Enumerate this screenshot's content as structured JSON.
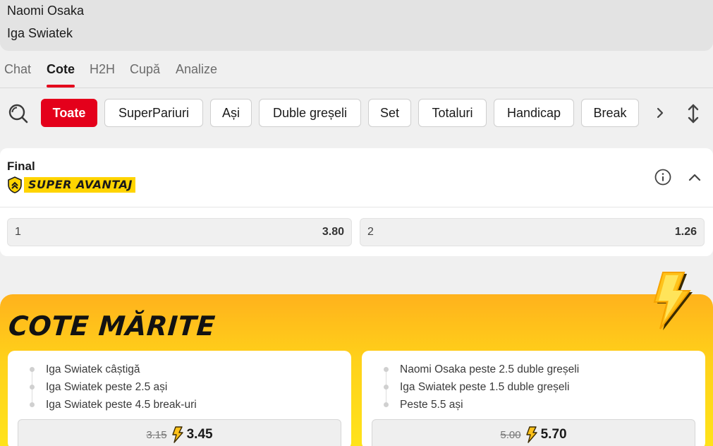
{
  "match": {
    "player1": "Naomi Osaka",
    "player2": "Iga Swiatek"
  },
  "tabs": [
    "Chat",
    "Cote",
    "H2H",
    "Cupă",
    "Analize"
  ],
  "active_tab": "Cote",
  "filters": [
    "Toate",
    "SuperPariuri",
    "Ași",
    "Duble greșeli",
    "Set",
    "Totaluri",
    "Handicap",
    "Break"
  ],
  "active_filter": "Toate",
  "market": {
    "title": "Final",
    "badge": "SUPER AVANTAJ",
    "outcomes": [
      {
        "label": "1",
        "odd": "3.80"
      },
      {
        "label": "2",
        "odd": "1.26"
      }
    ]
  },
  "boosted": {
    "title": "COTE MĂRITE",
    "cards": [
      {
        "selections": [
          "Iga Swiatek câștigă",
          "Iga Swiatek peste 2.5 ași",
          "Iga Swiatek peste 4.5 break-uri"
        ],
        "old_odd": "3.15",
        "new_odd": "3.45"
      },
      {
        "selections": [
          "Naomi Osaka peste 2.5 duble greșeli",
          "Iga Swiatek peste 1.5 duble greșeli",
          "Peste 5.5 ași"
        ],
        "old_odd": "5.00",
        "new_odd": "5.70"
      }
    ]
  },
  "colors": {
    "brand_red": "#e4001b",
    "badge_yellow": "#ffd400",
    "boost_orange": "#ffb21c"
  },
  "icons": [
    "search-icon",
    "chevron-right-icon",
    "expand-vertical-icon",
    "shield-icon",
    "info-icon",
    "chevron-up-icon",
    "lightning-icon"
  ]
}
